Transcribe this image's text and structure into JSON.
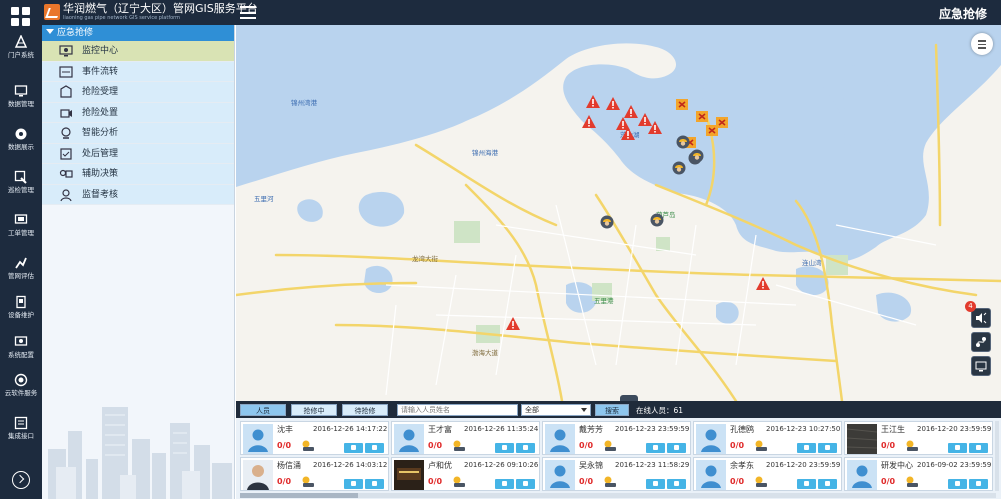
{
  "app": {
    "brand": "华润燃气（辽宁大区）管网GIS服务平台",
    "brand_sub": "liaoning gas pipe network GIS service platform",
    "page_title": "应急抢修"
  },
  "rail": [
    {
      "label": "门户系统",
      "icon": "portal-icon"
    },
    {
      "label": "数据管理",
      "icon": "data-manage-icon"
    },
    {
      "label": "数据展示",
      "icon": "data-display-icon"
    },
    {
      "label": "巡检管理",
      "icon": "inspection-icon"
    },
    {
      "label": "工单管理",
      "icon": "workorder-icon"
    },
    {
      "label": "管网评估",
      "icon": "network-eval-icon"
    },
    {
      "label": "设备维护",
      "icon": "equipment-icon"
    },
    {
      "label": "系统配置",
      "icon": "system-config-icon"
    },
    {
      "label": "云软件服务",
      "icon": "cloud-service-icon"
    },
    {
      "label": "集成接口",
      "icon": "integration-icon"
    }
  ],
  "menu": {
    "header": "应急抢修",
    "items": [
      {
        "label": "监控中心",
        "icon": "monitor-icon",
        "active": true
      },
      {
        "label": "事件流转",
        "icon": "event-flow-icon"
      },
      {
        "label": "抢险受理",
        "icon": "accept-icon"
      },
      {
        "label": "抢险处置",
        "icon": "dispose-icon"
      },
      {
        "label": "智能分析",
        "icon": "analysis-icon"
      },
      {
        "label": "处后管理",
        "icon": "after-manage-icon"
      },
      {
        "label": "辅助决策",
        "icon": "decision-icon"
      },
      {
        "label": "监督考核",
        "icon": "supervise-icon"
      }
    ]
  },
  "map": {
    "labels": [
      {
        "text": "锦州湾港",
        "kind": "water"
      },
      {
        "text": "锦州海港",
        "kind": "water"
      },
      {
        "text": "五里河",
        "kind": "water"
      },
      {
        "text": "茨山湖",
        "kind": "water"
      },
      {
        "text": "连山湾",
        "kind": "water"
      },
      {
        "text": "渤海大道",
        "kind": "road"
      },
      {
        "text": "龙湾大街",
        "kind": "road"
      },
      {
        "text": "葫芦岛",
        "kind": "green"
      },
      {
        "text": "五里港",
        "kind": "green"
      }
    ],
    "badge_count": "4"
  },
  "panel": {
    "filters": {
      "all": "人员",
      "busy": "抢修中",
      "idle": "待抢修",
      "search_placeholder": "请输入人员姓名",
      "select_value": "全部",
      "search_button": "搜索",
      "online_label": "在线人员：61"
    },
    "people": [
      {
        "name": "沈丰",
        "time": "2016-12-26 14:17:22",
        "status": "0/0",
        "avatar": "default"
      },
      {
        "name": "王才富",
        "time": "2016-12-26 11:35:24",
        "status": "0/0",
        "avatar": "default"
      },
      {
        "name": "戴芳芳",
        "time": "2016-12-23 23:59:59",
        "status": "0/0",
        "avatar": "default"
      },
      {
        "name": "孔德鸥",
        "time": "2016-12-23 10:27:50",
        "status": "0/0",
        "avatar": "default"
      },
      {
        "name": "王江生",
        "time": "2016-12-20 23:59:59",
        "status": "0/0",
        "avatar": "photo-dark"
      },
      {
        "name": "杨信涌",
        "time": "2016-12-26 14:03:12",
        "status": "0/0",
        "avatar": "photo-man"
      },
      {
        "name": "卢和优",
        "time": "2016-12-26 09:10:26",
        "status": "0/0",
        "avatar": "photo-sign"
      },
      {
        "name": "吴永锦",
        "time": "2016-12-23 11:58:29",
        "status": "0/0",
        "avatar": "default"
      },
      {
        "name": "余孝东",
        "time": "2016-12-20 23:59:59",
        "status": "0/0",
        "avatar": "default"
      },
      {
        "name": "研发中心",
        "time": "2016-09-02 23:59:59",
        "status": "0/0",
        "avatar": "default"
      }
    ]
  },
  "colors": {
    "rail_bg": "#1d2b3e",
    "menu_header": "#2f8fd6",
    "menu_active": "#d9e3b4",
    "alert_red": "#e23b2d",
    "action_blue": "#45b4e6"
  }
}
